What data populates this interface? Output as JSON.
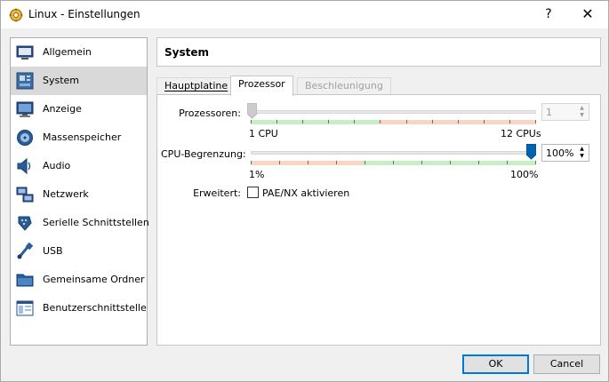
{
  "window": {
    "title": "Linux - Einstellungen",
    "help_label": "?",
    "close_label": "✕"
  },
  "sidebar": {
    "items": [
      {
        "label": "Allgemein",
        "icon": "general-icon"
      },
      {
        "label": "System",
        "icon": "motherboard-icon",
        "active": true
      },
      {
        "label": "Anzeige",
        "icon": "monitor-icon"
      },
      {
        "label": "Massenspeicher",
        "icon": "storage-icon"
      },
      {
        "label": "Audio",
        "icon": "speaker-icon"
      },
      {
        "label": "Netzwerk",
        "icon": "network-icon"
      },
      {
        "label": "Serielle Schnittstellen",
        "icon": "serial-port-icon"
      },
      {
        "label": "USB",
        "icon": "usb-icon"
      },
      {
        "label": "Gemeinsame Ordner",
        "icon": "shared-folder-icon"
      },
      {
        "label": "Benutzerschnittstelle",
        "icon": "user-interface-icon"
      }
    ]
  },
  "header": {
    "title": "System"
  },
  "tabs": [
    {
      "label": "Hauptplatine",
      "underline_char": "H"
    },
    {
      "label": "Prozessor",
      "underline_char": "P",
      "active": true
    },
    {
      "label": "Beschleunigung",
      "underline_char": "B",
      "disabled": true
    }
  ],
  "processor": {
    "label": "Prozessoren:",
    "value": "1",
    "min_label": "1 CPU",
    "max_label": "12 CPUs",
    "slider_fraction": 0.0,
    "disabled": true
  },
  "cpu_limit": {
    "label": "CPU-Begrenzung:",
    "value": "100%",
    "min_label": "1%",
    "max_label": "100%",
    "slider_fraction": 1.0
  },
  "extended": {
    "label": "Erweitert:",
    "checkbox_label": "PAE/NX aktivieren",
    "checked": false
  },
  "buttons": {
    "ok": "OK",
    "cancel": "Cancel"
  },
  "colors": {
    "zone_green": "#c6efc6",
    "zone_red": "#f9d5c4",
    "handle_blue": "#0063b1",
    "handle_disabled": "#cccccc",
    "selected_bg": "#d9d9d9"
  }
}
